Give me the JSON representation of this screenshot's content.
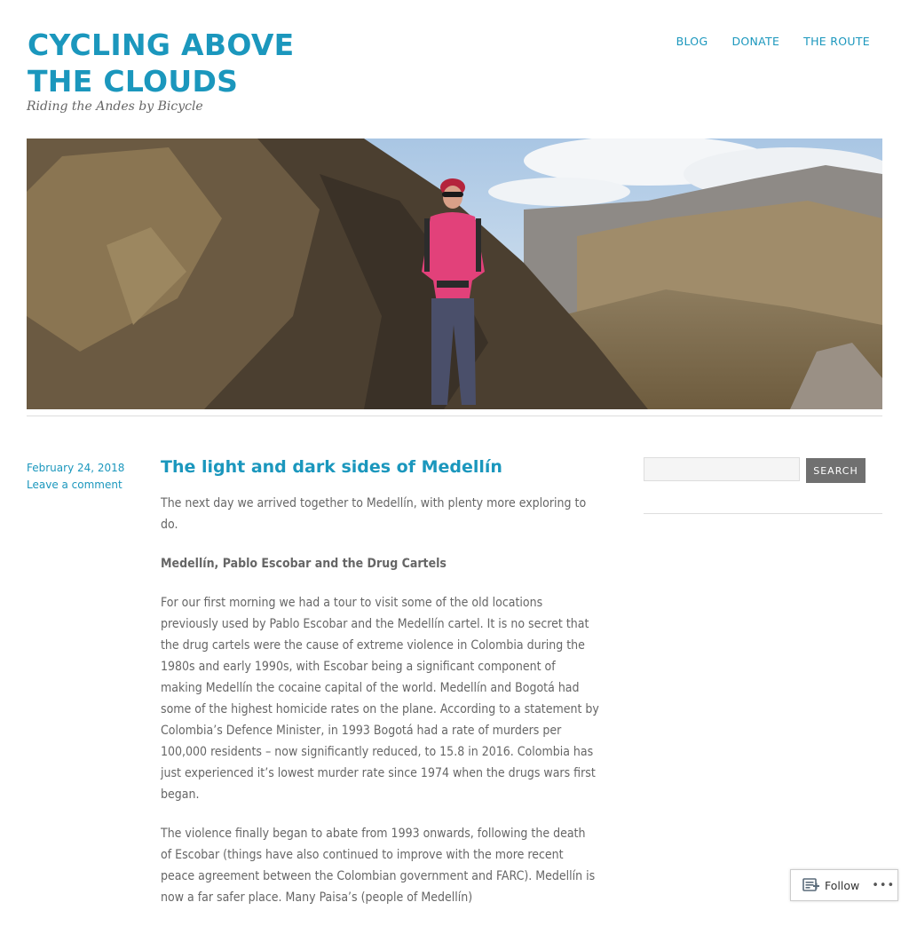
{
  "site": {
    "title": "CYCLING ABOVE THE CLOUDS",
    "tagline": "Riding the Andes by Bicycle"
  },
  "nav": {
    "items": [
      "BLOG",
      "DONATE",
      "THE ROUTE"
    ]
  },
  "post": {
    "date": "February 24, 2018",
    "comment_link": "Leave a comment",
    "title": "The light and dark sides of Medellín",
    "paragraphs": [
      "The next day we arrived together to Medellín, with plenty more exploring to do.",
      "Medellín, Pablo Escobar and the Drug Cartels",
      "For our first morning we had a tour to visit some of the old locations previously used by Pablo Escobar and the Medellín cartel. It is no secret that the drug cartels were the cause of extreme violence in Colombia during the 1980s and early 1990s, with Escobar being a significant component of making Medellín the cocaine capital of the world. Medellín and Bogotá had some of the highest homicide rates on the plane. According to a statement by Colombia’s Defence Minister, in 1993 Bogotá had a rate of murders per 100,000 residents – now significantly reduced, to 15.8 in 2016. Colombia has just experienced it’s lowest murder rate since 1974 when the drugs wars first began.",
      "The violence finally began to abate from 1993 onwards, following the death of Escobar (things have also continued to improve with the more recent peace agreement between the Colombian government and FARC). Medellín is now a far safer place. Many Paisa’s (people of Medellín)"
    ]
  },
  "sidebar": {
    "search_placeholder": "",
    "search_button": "SEARCH"
  },
  "follow": {
    "label": "Follow",
    "icon": "follow-reader-icon",
    "more": "•••"
  },
  "colors": {
    "accent": "#1b97bd",
    "text": "#666666",
    "button": "#707070"
  }
}
